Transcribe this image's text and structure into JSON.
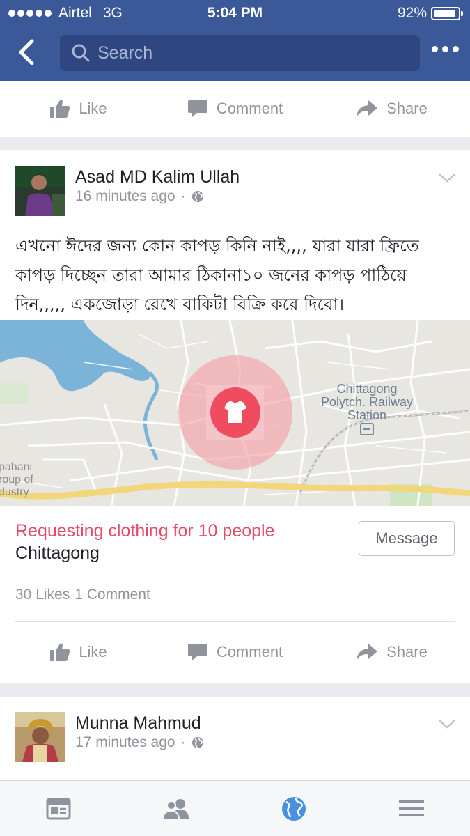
{
  "status_bar": {
    "carrier": "Airtel",
    "network": "3G",
    "time": "5:04 PM",
    "battery_text": "92%",
    "battery_level": 0.92
  },
  "header": {
    "back_icon": "chevron-left-icon",
    "search_placeholder": "Search",
    "more_icon": "more-dots-icon"
  },
  "actions_labels": {
    "like": "Like",
    "comment": "Comment",
    "share": "Share"
  },
  "post": {
    "author": "Asad MD Kalim Ullah",
    "time": "16 minutes ago",
    "privacy_icon": "globe-icon",
    "text_lines": [
      "এখনো ঈদের জন্য কোন কাপড় কিনি নাই,,,, যারা যারা ফ্রিতে",
      "কাপড় দিচ্ছেন তারা আমার    ঠিকানা১০ জনের কাপড় পাঠিয়ে",
      "দিন,,,,, একজোড়া রেখে বাকিটা বিক্রি করে দিবো।"
    ],
    "map": {
      "label_station_1": "Chittagong",
      "label_station_2": "Polytch. Railway",
      "label_station_3": "Station",
      "label_left_1": "pahani",
      "label_left_2": "roup of",
      "label_left_3": "dustry",
      "pin_icon": "tshirt-icon"
    },
    "request_title": "Requesting clothing for 10 people",
    "request_location": "Chittagong",
    "message_button": "Message",
    "likes": "30 Likes",
    "comments": "1 Comment"
  },
  "next_post": {
    "author": "Munna Mahmud",
    "time": "17 minutes ago",
    "privacy_icon": "globe-icon"
  },
  "tabbar": {
    "tabs": [
      "news-feed-icon",
      "friends-icon",
      "globe-notifications-icon",
      "menu-icon"
    ],
    "active": "globe-notifications-icon"
  },
  "colors": {
    "brand_blue": "#3b5998",
    "request_red": "#e74a65",
    "active_tab_blue": "#4a90e2"
  }
}
